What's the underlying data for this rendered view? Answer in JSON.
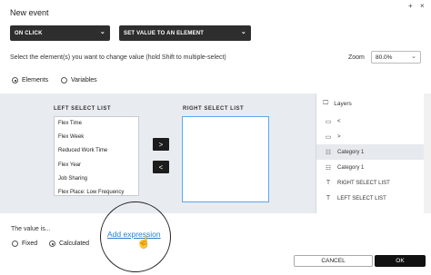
{
  "window": {
    "title": "New event",
    "plus_symbol": "+",
    "close_symbol": "×"
  },
  "trigger_dropdown": {
    "value": "ON CLICK"
  },
  "action_dropdown": {
    "value": "SET VALUE TO AN ELEMENT"
  },
  "instruction": "Select the element(s) you want to change value (hold Shift to multiple-select)",
  "zoom": {
    "label": "Zoom",
    "value": "80.0%"
  },
  "mode_radios": [
    {
      "label": "Elements",
      "selected": true
    },
    {
      "label": "Variables",
      "selected": false
    }
  ],
  "left_list": {
    "label": "LEFT SELECT LIST",
    "items": [
      "Flex Time",
      "Flex Week",
      "Reduced Work Time",
      "Flex Year",
      "Job Sharing",
      "Flex Place: Low Frequency"
    ]
  },
  "right_list": {
    "label": "RIGHT SELECT LIST",
    "items": []
  },
  "move_buttons": {
    "right": ">",
    "left": "<"
  },
  "layers": {
    "title": "Layers",
    "items": [
      {
        "label": "<",
        "icon": "button-icon",
        "selected": false
      },
      {
        "label": ">",
        "icon": "button-icon",
        "selected": false
      },
      {
        "label": "Category 1",
        "icon": "list-icon",
        "selected": true
      },
      {
        "label": "Category 1",
        "icon": "list-icon",
        "selected": false
      },
      {
        "label": "RIGHT SELECT LIST",
        "icon": "text-icon",
        "selected": false
      },
      {
        "label": "LEFT SELECT LIST",
        "icon": "text-icon",
        "selected": false
      }
    ]
  },
  "value_section": {
    "label": "The value is...",
    "radios": [
      {
        "label": "Fixed",
        "selected": false
      },
      {
        "label": "Calculated",
        "selected": true
      }
    ],
    "add_expression": "Add expression"
  },
  "footer": {
    "cancel": "CANCEL",
    "ok": "OK"
  }
}
